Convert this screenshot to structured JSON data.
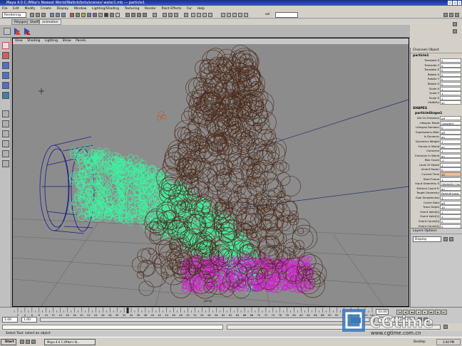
{
  "window": {
    "title": "Maya 4.0 C:/Mike's Newest World/Walkrb/bcts/scenes/ water1.mb   ---   particle1"
  },
  "menubar": {
    "items": [
      "File",
      "Edit",
      "Modify",
      "Create",
      "Display",
      "Window",
      "Lighting/Shading",
      "Texturing",
      "Render",
      "Paint Effects",
      "Fur",
      "Help"
    ]
  },
  "statusline": {
    "mode": "Rendering",
    "sel_label": "sel"
  },
  "shelf": {
    "tabs": [
      "Polygons",
      "Shelf1",
      "animation"
    ]
  },
  "viewport": {
    "menu": [
      "View",
      "Shading",
      "Lighting",
      "Show",
      "Panels"
    ],
    "camera_label": "persp"
  },
  "channelbox": {
    "tabs": "Channels   Object",
    "node": "particle1",
    "shapes_label": "SHAPES",
    "shape_node": "particleShape1",
    "transform": [
      {
        "label": "Translate X",
        "value": "0"
      },
      {
        "label": "Translate Y",
        "value": "0"
      },
      {
        "label": "Translate Z",
        "value": "0"
      },
      {
        "label": "Rotate X",
        "value": "0"
      },
      {
        "label": "Rotate Y",
        "value": "0"
      },
      {
        "label": "Rotate Z",
        "value": "0"
      },
      {
        "label": "Scale X",
        "value": "1"
      },
      {
        "label": "Scale Y",
        "value": "1"
      },
      {
        "label": "Scale Z",
        "value": "1"
      },
      {
        "label": "Visibility",
        "value": "on"
      }
    ],
    "shape": [
      {
        "label": "Die On Emission",
        "value": "off"
      },
      {
        "label": "Lifespan Mode",
        "value": "Constant"
      },
      {
        "label": "Lifespan Random",
        "value": "0"
      },
      {
        "label": "Expressions After",
        "value": "off"
      },
      {
        "label": "Is Dynamic",
        "value": "on"
      },
      {
        "label": "Dynamics Weight",
        "value": "1"
      },
      {
        "label": "Forces In World",
        "value": "on"
      },
      {
        "label": "Conserve",
        "value": "1"
      },
      {
        "label": "Emission In World",
        "value": "on"
      },
      {
        "label": "Max Count",
        "value": "-1"
      },
      {
        "label": "Level Of Detail",
        "value": "1"
      },
      {
        "label": "Inherit Factor",
        "value": "0"
      },
      {
        "label": "Current Time",
        "value": "33",
        "keyed": true
      },
      {
        "label": "Start Frame",
        "value": "1"
      },
      {
        "label": "Input Geometry S",
        "value": "Geometry Loc"
      },
      {
        "label": "Enforce Count Fr",
        "value": "on"
      },
      {
        "label": "Target Geometry",
        "value": "Particle Loca"
      },
      {
        "label": "Goal Smoothness",
        "value": "3"
      },
      {
        "label": "Cache Data",
        "value": "off"
      },
      {
        "label": "Trace Depth",
        "value": "10"
      },
      {
        "label": "Event Valid[0]",
        "value": "1"
      },
      {
        "label": "Event Valid[1]",
        "value": "1"
      },
      {
        "label": "Event Count[0]",
        "value": "0"
      },
      {
        "label": "Event Count[1]",
        "value": "0"
      }
    ]
  },
  "layers": {
    "tabs": "Layers   Options",
    "mode": "Display"
  },
  "timeline": {
    "ticks": [
      "2",
      "4",
      "6",
      "8",
      "10",
      "12",
      "14",
      "16",
      "18",
      "20",
      "22",
      "24",
      "26",
      "28",
      "30",
      "32",
      "34",
      "36",
      "38",
      "40",
      "42",
      "44",
      "46",
      "48",
      "50",
      "52",
      "54",
      "56",
      "58",
      "60",
      "62",
      "64",
      "66",
      "68",
      "70",
      "72",
      "74",
      "76",
      "78",
      "80",
      "82",
      "84",
      "86",
      "88",
      "90",
      "92",
      "94",
      "96",
      "98",
      "100",
      "102"
    ],
    "current": "33.00",
    "current_frame": 33,
    "range_start": 1,
    "range_end": 102,
    "start_field": "1.00",
    "start_field2": "1.00",
    "end_field": "100.00",
    "end_field2": "100.00"
  },
  "help": {
    "text": "Select Tool: select an object"
  },
  "taskbar": {
    "start": "Start",
    "item": "Maya 4.0 C:/Mike's N...",
    "clock": "3:40 PM",
    "desktop": "Desktop"
  },
  "watermark": {
    "brand": "CGtime",
    "url": "www.cgtime.com.cn"
  },
  "colors": {
    "particles_green": "#40f0a0",
    "particles_brown": "#4a2a1a",
    "particles_magenta": "#d020d0",
    "viewport_bg": "#8c8c8c",
    "wire_blue": "#1a1a8a"
  }
}
